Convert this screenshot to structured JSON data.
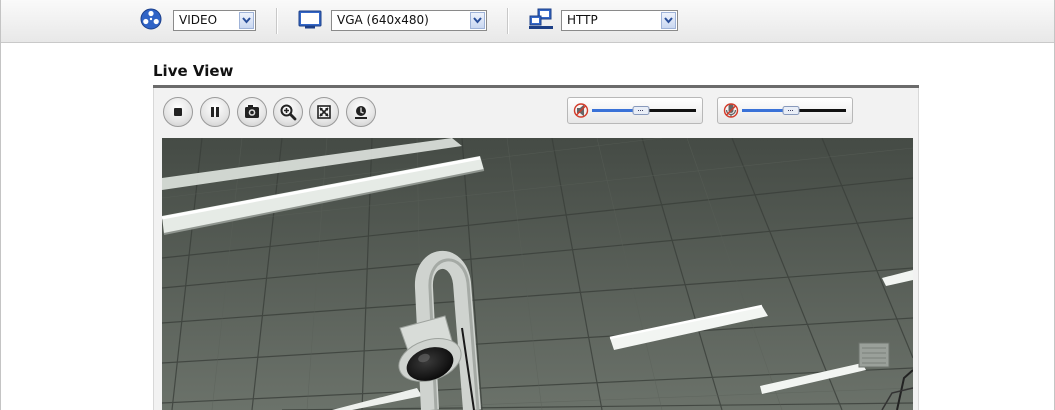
{
  "toolbar": {
    "stream_type": {
      "icon": "video-reel-icon",
      "selected": "VIDEO"
    },
    "resolution": {
      "icon": "monitor-icon",
      "selected": "VGA (640x480)"
    },
    "protocol": {
      "icon": "network-icon",
      "selected": "HTTP"
    }
  },
  "live_view": {
    "title": "Live View",
    "controls": [
      {
        "name": "stop",
        "icon": "stop-icon"
      },
      {
        "name": "pause",
        "icon": "pause-icon"
      },
      {
        "name": "snapshot",
        "icon": "camera-icon"
      },
      {
        "name": "digital-zoom",
        "icon": "zoom-in-icon"
      },
      {
        "name": "full-screen",
        "icon": "fullscreen-icon"
      },
      {
        "name": "record",
        "icon": "record-icon"
      }
    ],
    "speaker_volume": {
      "icon": "speaker-muted-icon",
      "level": 0.5
    },
    "microphone_volume": {
      "icon": "microphone-muted-icon",
      "level": 0.5
    }
  },
  "colors": {
    "toolbar_bg": "#ececec",
    "select_arrow": "#c9d7f1",
    "title_rule": "#6b6b6b",
    "panel_bg": "#f2f2f2"
  }
}
